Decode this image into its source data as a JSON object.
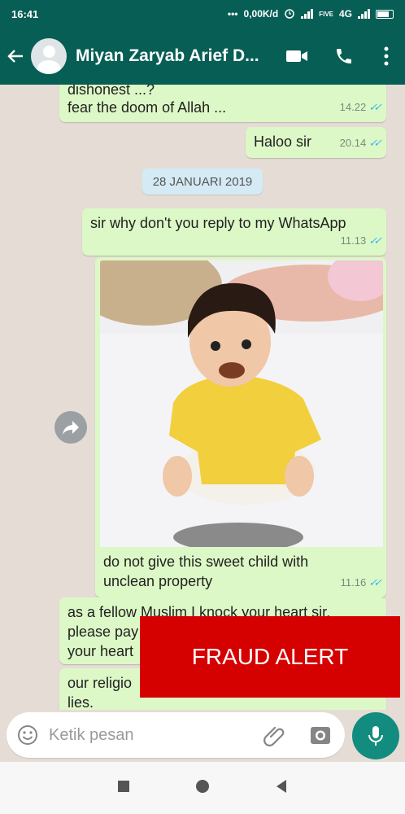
{
  "status_bar": {
    "time": "16:41",
    "net_speed": "0,00K/d",
    "network": "4G",
    "sim_label": "FIVE"
  },
  "header": {
    "contact_name": "Miyan Zaryab Arief D..."
  },
  "messages": [
    {
      "line1": "dishonest ...?",
      "line2": "fear the doom of Allah ...",
      "time": "14.22"
    },
    {
      "text": "Haloo sir",
      "time": "20.14"
    },
    {
      "text": "sir why don't you reply to my WhatsApp",
      "time": "11.13"
    },
    {
      "caption_line1": "do not give this sweet child with",
      "caption_line2": "unclean property",
      "time": "11.16"
    },
    {
      "line1": "as a fellow Muslim I knock your heart sir,",
      "line2": "please pay",
      "line3": "your heart"
    },
    {
      "line1": "our religio",
      "line2": "lies."
    }
  ],
  "date_divider": "28 JANUARI 2019",
  "overlay": {
    "label": "FRAUD ALERT",
    "color": "#d50000"
  },
  "composer": {
    "placeholder": "Ketik pesan"
  },
  "colors": {
    "header": "#075e54",
    "outgoing_bubble": "#dcf8c6",
    "chat_bg": "#e5ddd5",
    "mic_button": "#128c7e",
    "read_ticks": "#34b7f1"
  }
}
